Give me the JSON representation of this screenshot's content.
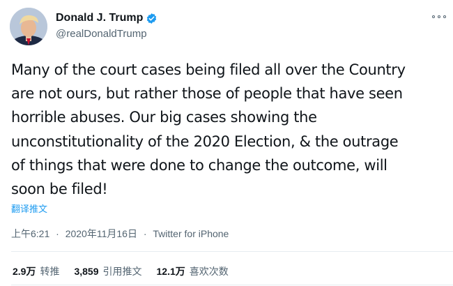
{
  "author": {
    "display_name": "Donald J. Trump",
    "handle": "@realDonaldTrump",
    "verified": true,
    "verified_color": "#1d9bf0"
  },
  "tweet": {
    "text_lines": [
      "Many of the court cases being filed all over the Country",
      "are not ours, but rather those of people that have seen",
      "horrible abuses. Our big cases showing the",
      "unconstitutionality of the 2020 Election, & the outrage",
      "of things that were done to change the outcome, will",
      "soon be filed!"
    ],
    "translate_label": "翻译推文"
  },
  "meta": {
    "time": "上午6:21",
    "separator": "·",
    "date": "2020年11月16日",
    "source": "Twitter for iPhone"
  },
  "stats": {
    "retweets": {
      "value": "2.9万",
      "label": "转推"
    },
    "quotes": {
      "value": "3,859",
      "label": "引用推文"
    },
    "likes": {
      "value": "12.1万",
      "label": "喜欢次数"
    }
  },
  "icons": {
    "more": "more-icon",
    "verified": "verified-badge-icon"
  }
}
